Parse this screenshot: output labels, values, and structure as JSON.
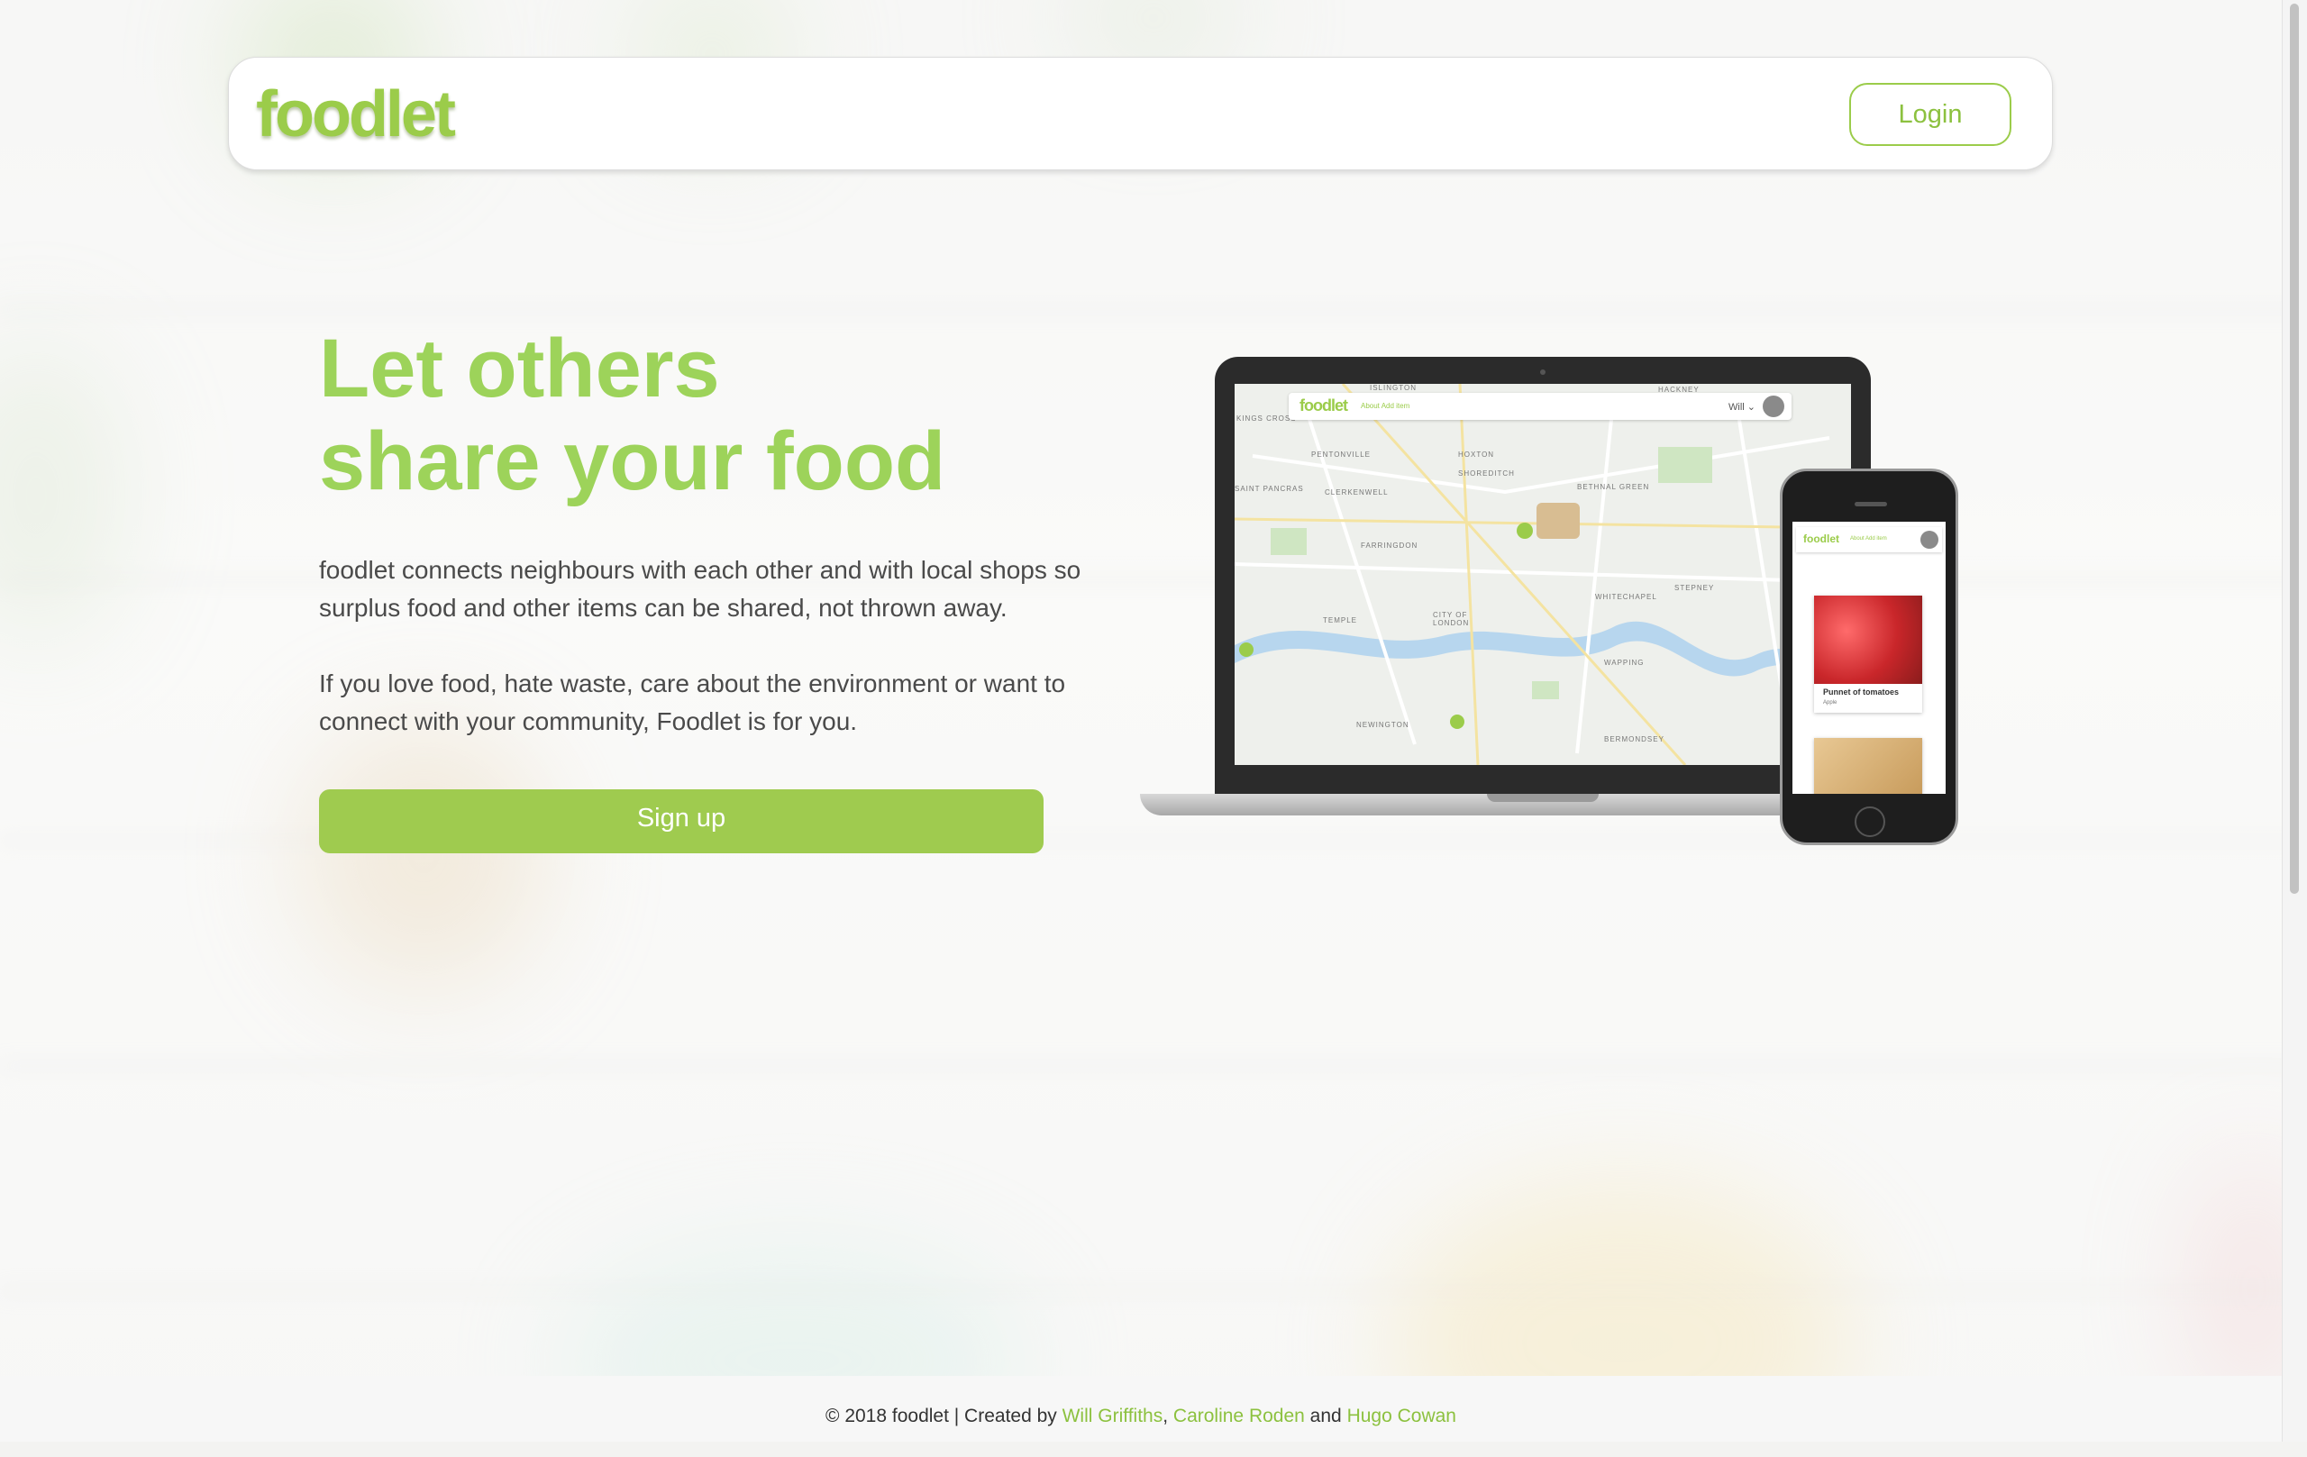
{
  "colors": {
    "brand_green": "#9bcc4a",
    "title_green": "#9dd35a",
    "button_green": "#9fcb4f",
    "link_green": "#8cc13f",
    "body_text": "#4a4a4a"
  },
  "navbar": {
    "logo_text": "foodlet",
    "login_label": "Login"
  },
  "hero": {
    "title_line1": "Let others",
    "title_line2": "share your food",
    "paragraph1": "foodlet connects neighbours with each other and with local shops so surplus food and other items can be shared, not thrown away.",
    "paragraph2": "If you love food, hate waste, care about the environment or want to connect with your community, Foodlet is for you.",
    "signup_label": "Sign up"
  },
  "mockup": {
    "laptop": {
      "app_logo": "foodlet",
      "nav_links": "About   Add item",
      "user_name": "Will ⌄",
      "map_labels": [
        "ISLINGTON",
        "HACKNEY",
        "KINGS CROSS",
        "PENTONVILLE",
        "HOXTON",
        "SHOREDITCH",
        "CLERKENWELL",
        "BETHNAL GREEN",
        "SAINT PANCRAS",
        "FARRINGDON",
        "WHITECHAPEL",
        "CITY OF LONDON",
        "STEPNEY",
        "TEMPLE",
        "NEWINGTON",
        "BERMONDSEY",
        "WAPPING"
      ]
    },
    "phone": {
      "app_logo": "foodlet",
      "nav_links": "About  Add item",
      "card_title": "Punnet of tomatoes",
      "card_sub": "Apple"
    }
  },
  "footer": {
    "prefix": "© 2018 foodlet | Created by ",
    "author1": "Will Griffiths",
    "sep1": ", ",
    "author2": "Caroline Roden",
    "sep2": " and ",
    "author3": "Hugo Cowan"
  }
}
